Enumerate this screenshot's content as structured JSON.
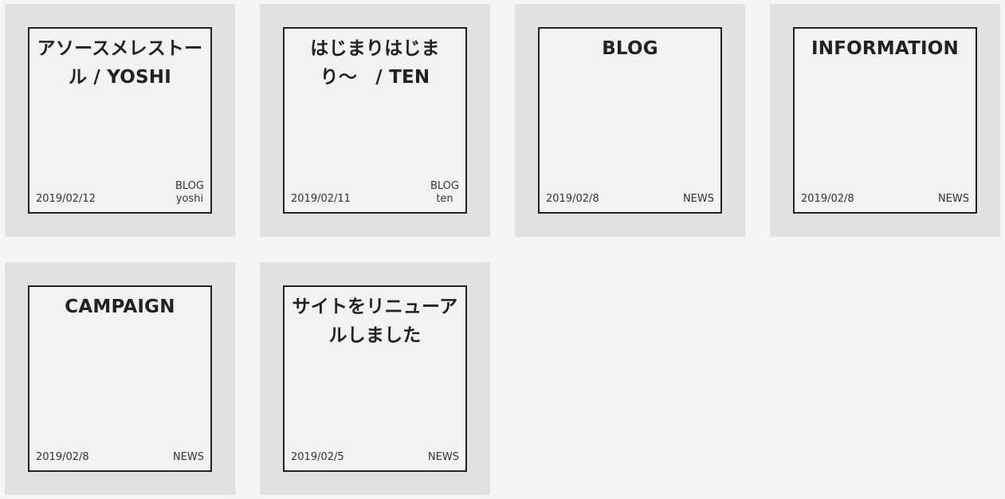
{
  "posts": [
    {
      "title": "アソースメレストール / YOSHI",
      "date": "2019/02/12",
      "category": "BLOG",
      "author": "yoshi"
    },
    {
      "title": "はじまりはじまり〜　/ TEN",
      "date": "2019/02/11",
      "category": "BLOG",
      "author": "ten"
    },
    {
      "title": "BLOG",
      "date": "2019/02/8",
      "category": "NEWS",
      "author": ""
    },
    {
      "title": "INFORMATION",
      "date": "2019/02/8",
      "category": "NEWS",
      "author": ""
    },
    {
      "title": "CAMPAIGN",
      "date": "2019/02/8",
      "category": "NEWS",
      "author": ""
    },
    {
      "title": "サイトをリニューアルしました",
      "date": "2019/02/5",
      "category": "NEWS",
      "author": ""
    }
  ]
}
